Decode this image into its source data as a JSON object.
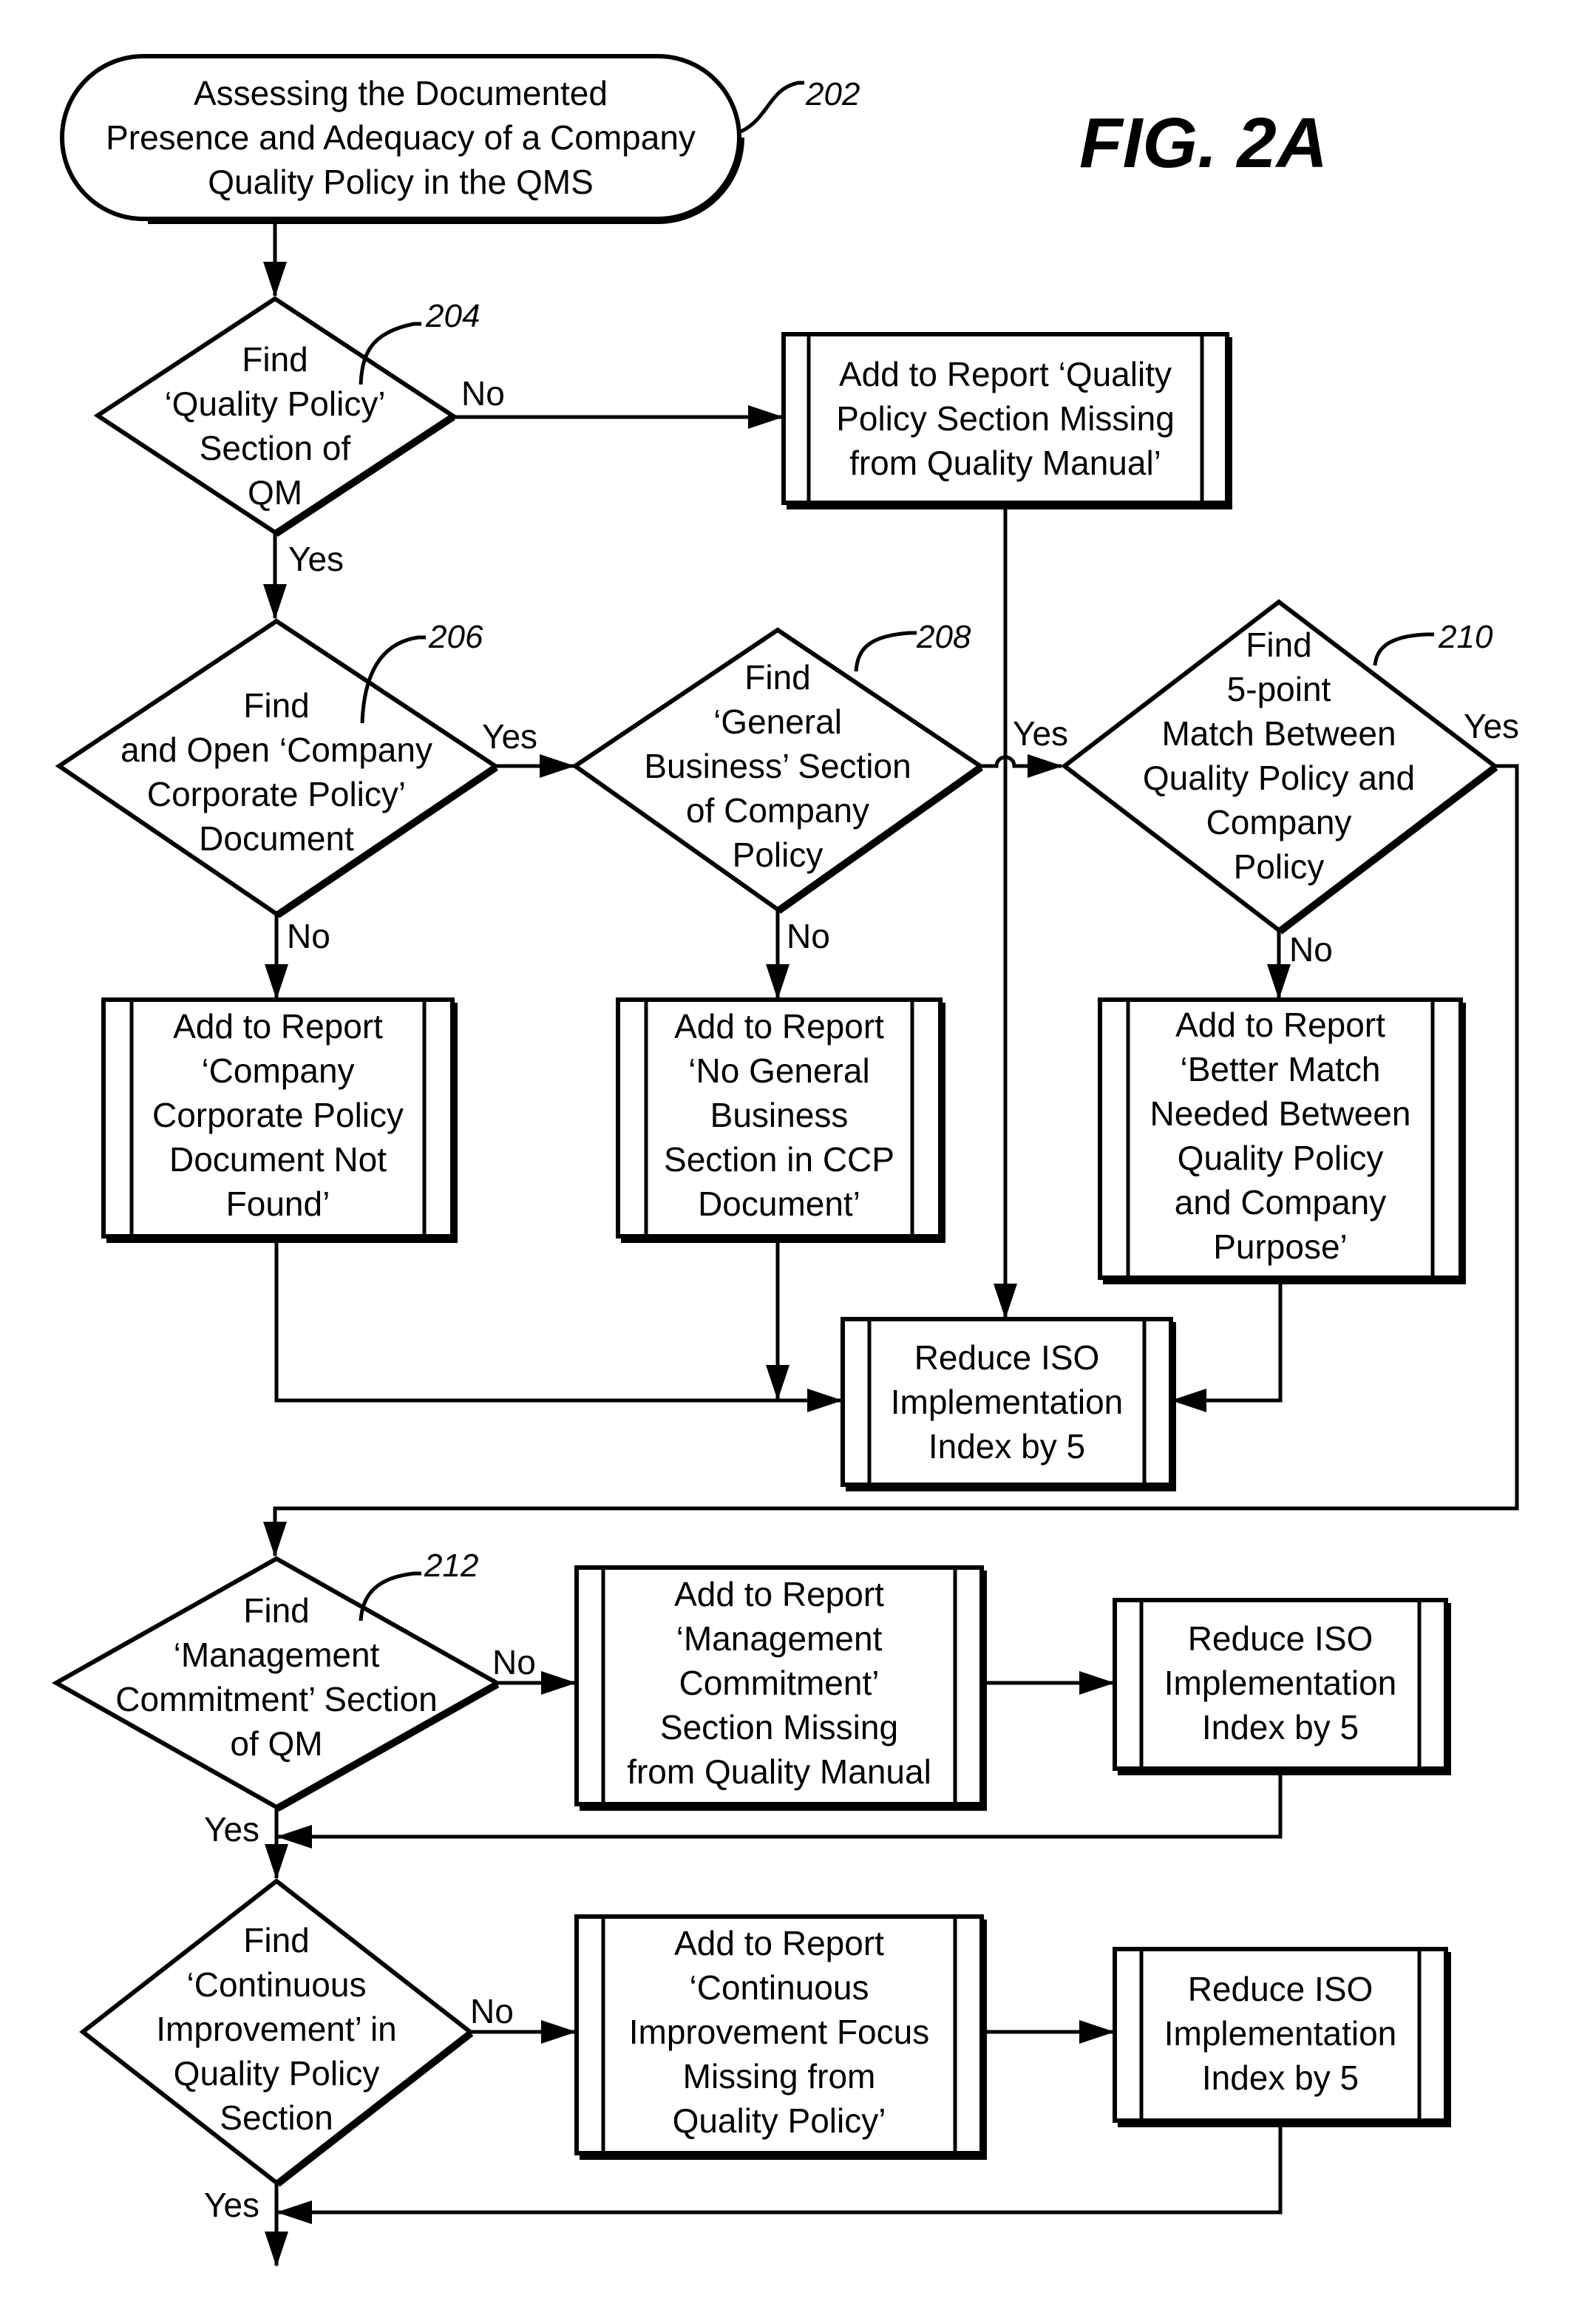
{
  "figure": {
    "title": "FIG. 2A",
    "ink_color": "#000000",
    "background": "#ffffff"
  },
  "nodes": {
    "start": {
      "ref": "202",
      "lines": [
        "Assessing the Documented",
        "Presence and Adequacy of a Company",
        "Quality Policy in the QMS"
      ]
    },
    "d204": {
      "ref": "204",
      "lines": [
        "Find",
        "‘Quality Policy’",
        "Section of",
        "QM"
      ]
    },
    "p_qpsm": {
      "lines": [
        "Add to Report ‘Quality",
        "Policy Section Missing",
        "from Quality Manual’"
      ]
    },
    "d206": {
      "ref": "206",
      "lines": [
        "Find",
        "and Open ‘Company",
        "Corporate Policy’",
        "Document"
      ]
    },
    "d208": {
      "ref": "208",
      "lines": [
        "Find",
        "‘General",
        "Business’ Section",
        "of Company",
        "Policy"
      ]
    },
    "d210": {
      "ref": "210",
      "lines": [
        "Find",
        "5-point",
        "Match Between",
        "Quality Policy and",
        "Company",
        "Policy"
      ]
    },
    "p_ccpnf": {
      "lines": [
        "Add to Report",
        "‘Company",
        "Corporate Policy",
        "Document Not",
        "Found’"
      ]
    },
    "p_ngbs": {
      "lines": [
        "Add to Report",
        "‘No General",
        "Business",
        "Section in CCP",
        "Document’"
      ]
    },
    "p_bmn": {
      "lines": [
        "Add to Report",
        "‘Better Match",
        "Needed Between",
        "Quality Policy",
        "and Company",
        "Purpose’"
      ]
    },
    "p_reduce1": {
      "lines": [
        "Reduce ISO",
        "Implementation",
        "Index by 5"
      ]
    },
    "d212": {
      "ref": "212",
      "lines": [
        "Find",
        "‘Management",
        "Commitment’ Section",
        "of QM"
      ]
    },
    "p_mcsm": {
      "lines": [
        "Add to Report",
        "‘Management",
        "Commitment’",
        "Section Missing",
        "from Quality Manual"
      ]
    },
    "p_reduce2": {
      "lines": [
        "Reduce ISO",
        "Implementation",
        "Index by 5"
      ]
    },
    "d_ci": {
      "lines": [
        "Find",
        "‘Continuous",
        "Improvement’ in",
        "Quality Policy",
        "Section"
      ]
    },
    "p_cif": {
      "lines": [
        "Add to Report",
        "‘Continuous",
        "Improvement Focus",
        "Missing from",
        "Quality Policy’"
      ]
    },
    "p_reduce3": {
      "lines": [
        "Reduce ISO",
        "Implementation",
        "Index by 5"
      ]
    }
  },
  "edge_labels": {
    "d204_no": "No",
    "d204_yes": "Yes",
    "d206_yes": "Yes",
    "d206_no": "No",
    "d208_yes": "Yes",
    "d208_no": "No",
    "d210_yes": "Yes",
    "d210_no": "No",
    "d212_no": "No",
    "d212_yes": "Yes",
    "d_ci_no": "No",
    "d_ci_yes": "Yes"
  }
}
